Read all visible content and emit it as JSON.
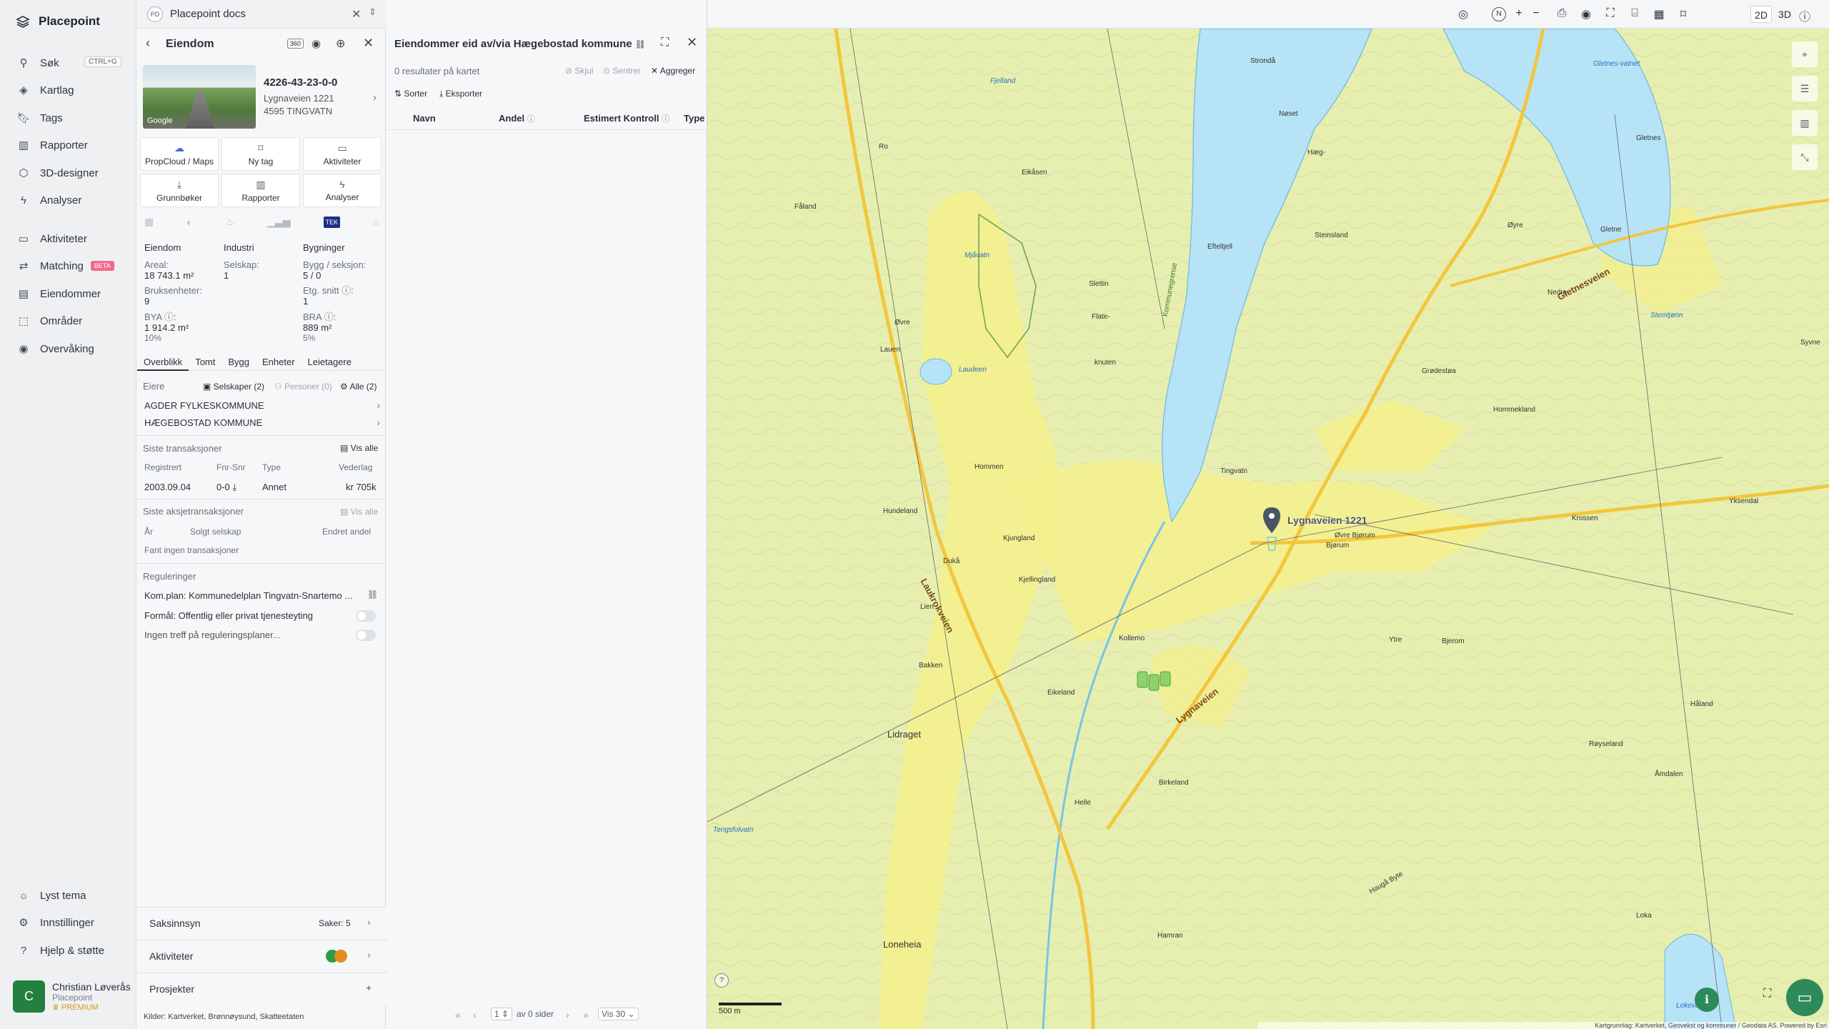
{
  "nav": {
    "brand": "Placepoint",
    "items": [
      {
        "label": "Søk",
        "icon": "search-icon"
      },
      {
        "label": "Kartlag",
        "icon": "layers-icon"
      },
      {
        "label": "Tags",
        "icon": "bookmark-icon"
      },
      {
        "label": "Rapporter",
        "icon": "chart-icon"
      },
      {
        "label": "3D-designer",
        "icon": "cube-icon"
      },
      {
        "label": "Analyser",
        "icon": "lightning-icon"
      },
      {
        "label": "Aktiviteter",
        "icon": "chat-icon"
      },
      {
        "label": "Matching",
        "icon": "handshake-icon"
      },
      {
        "label": "Eiendommer",
        "icon": "building-icon"
      },
      {
        "label": "Områder",
        "icon": "area-icon"
      },
      {
        "label": "Overvåking",
        "icon": "monitor-icon"
      }
    ],
    "search_shortcut": "CTRL+G",
    "beta_badge": "BETA",
    "bottom": [
      {
        "label": "Lyst tema",
        "icon": "sun-icon"
      },
      {
        "label": "Innstillinger",
        "icon": "gear-icon"
      },
      {
        "label": "Hjelp & støtte",
        "icon": "help-icon"
      }
    ],
    "user": {
      "initial": "C",
      "name": "Christian Løverås",
      "org": "Placepoint",
      "plan": "PREMIUM"
    }
  },
  "docs_tab": {
    "badge": "PD",
    "title": "Placepoint docs"
  },
  "property": {
    "header": "Eiendom",
    "badge_360": "360",
    "id": "4226-43-23-0-0",
    "address1": "Lygnaveien 1221",
    "address2": "4595 TINGVATN",
    "photo_credit": "Google",
    "actions": [
      {
        "label": "PropCloud / Maps",
        "icon": "cloud-icon"
      },
      {
        "label": "Ny tag",
        "icon": "tag-icon"
      },
      {
        "label": "Aktiviteter",
        "icon": "chat-icon"
      },
      {
        "label": "Grunnbøker",
        "icon": "download-icon"
      },
      {
        "label": "Rapporter",
        "icon": "chart-icon"
      },
      {
        "label": "Analyser",
        "icon": "bolt-icon"
      }
    ],
    "tek_label": "TEK",
    "col_headers": [
      "Eiendom",
      "Industri",
      "Bygninger"
    ],
    "facts": {
      "areal_k": "Areal:",
      "areal_v": "18 743.1 m²",
      "bruks_k": "Bruksenheter:",
      "bruks_v": "9",
      "bya_k": "BYA ⓘ:",
      "bya_v": "1 914.2 m²",
      "bya_p": "10%",
      "selskap_k": "Selskap:",
      "selskap_v": "1",
      "bygg_k": "Bygg / seksjon:",
      "bygg_v": "5 / 0",
      "etg_k": "Etg. snitt ⓘ:",
      "etg_v": "1",
      "bra_k": "BRA ⓘ:",
      "bra_v": "889 m²",
      "bra_p": "5%"
    },
    "tabs": [
      "Overblikk",
      "Tomt",
      "Bygg",
      "Enheter",
      "Leietagere"
    ],
    "owners_title": "Eiere",
    "owner_filters": [
      "Selskaper (2)",
      "Personer (0)",
      "Alle (2)"
    ],
    "owners": [
      "AGDER FYLKESKOMMUNE",
      "HÆGEBOSTAD KOMMUNE"
    ],
    "trans_title": "Siste transaksjoner",
    "show_all": "Vis alle",
    "trans_headers": [
      "Registrert",
      "Fnr-Snr",
      "Type",
      "Vederlag"
    ],
    "trans_row": [
      "2003.09.04",
      "0-0",
      "Annet",
      "kr 705k"
    ],
    "share_title": "Siste aksjetransaksjoner",
    "share_headers": [
      "År",
      "Solgt selskap",
      "Endret andel"
    ],
    "share_empty": "Fant ingen transaksjoner",
    "reg_title": "Reguleringer",
    "reg_plan": "Kom.plan: Kommunedelplan Tingvatn-Snartemo ...",
    "reg_purpose": "Formål: Offentlig eller privat tjenesteyting",
    "reg_none": "Ingen treff på reguleringsplaner...",
    "sections": [
      {
        "label": "Saksinnsyn",
        "extra": "Saker: 5"
      },
      {
        "label": "Aktiviteter",
        "extra": ""
      },
      {
        "label": "Prosjekter",
        "extra": "+"
      }
    ],
    "sources": "Kilder:  Kartverket,  Brønnøysund,  Skatteetaten"
  },
  "results": {
    "title": "Eiendommer eid av/via Hægebostad kommune",
    "count": "0 resultater på kartet",
    "hide": "Skjul",
    "center": "Sentrer",
    "aggregate": "Aggreger",
    "sort": "Sorter",
    "export": "Eksporter",
    "columns": [
      "Navn",
      "Andel",
      "Estimert Kontroll",
      "Type"
    ],
    "page": "1",
    "of_pages": "av 0 sider",
    "per_page": "Vis 30"
  },
  "map": {
    "mode_2d": "2D",
    "mode_3d": "3D",
    "scale": "500 m",
    "pin_label": "Lygnaveien 1221",
    "attribution": "Kartgrunnlag: Kartverket, Geovekst og kommuner / Geodata AS. Powered by Esri",
    "place_labels": [
      "Strondå",
      "Gletnes-vatnet",
      "Nøset",
      "Hæg-",
      "Gletnes",
      "Fjelland",
      "Ro",
      "Eikåsen",
      "Fåland",
      "Mjåvatn",
      "Efteltjell",
      "Steinsland",
      "Øyre",
      "Gletne",
      "Gletnesveien",
      "Slettin",
      "Øvre",
      "Flate-",
      "Lauen",
      "Stemtjønn",
      "Laudeen",
      "knuten",
      "Nedre",
      "Grødestøa",
      "Syvne",
      "Kommunegrense",
      "Tingvatn",
      "Hommen",
      "Hommekland",
      "Hundeland",
      "Krossen",
      "Yksendal",
      "Lygnaveien",
      "Bjørum",
      "Øvre Bjørum",
      "Kjungland",
      "Dukå",
      "Kjellingland",
      "Lien",
      "Kollemo",
      "Ytre",
      "Bjerom",
      "Bakken",
      "Eikeland",
      "Laukrokveien",
      "Lidraget",
      "Håland",
      "Røyseland",
      "Helle",
      "Birkeland",
      "Åmdalen",
      "Tengsfolvatn",
      "Haugå Byte",
      "Loneheia",
      "Hamran",
      "Loka",
      "Lokevannet"
    ]
  }
}
